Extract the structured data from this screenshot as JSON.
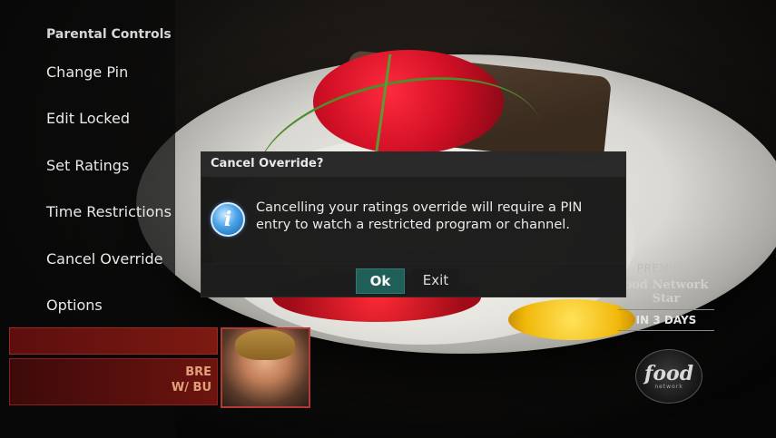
{
  "menu": {
    "title": "Parental Controls",
    "items": [
      {
        "label": "Change Pin"
      },
      {
        "label": "Edit Locked"
      },
      {
        "label": "Set Ratings"
      },
      {
        "label": "Time Restrictions"
      },
      {
        "label": "Cancel Override"
      },
      {
        "label": "Options"
      }
    ]
  },
  "dialog": {
    "title": "Cancel Override?",
    "message": "Cancelling your ratings override will require a PIN entry to watch a restricted program or channel.",
    "icon": "info-icon",
    "ok_label": "Ok",
    "exit_label": "Exit"
  },
  "promo": {
    "label": "PREMIERE",
    "show": "ood Network Star",
    "when": "IN 3 DAYS",
    "logo_text": "food",
    "logo_sub": "network"
  },
  "tiles": {
    "red_text_1": "BRE",
    "red_text_2": "W/ BU"
  },
  "colors": {
    "ok_button": "#1f5f57",
    "menu_bg": "#0a0a0a",
    "tile_red": "#6d140f"
  }
}
